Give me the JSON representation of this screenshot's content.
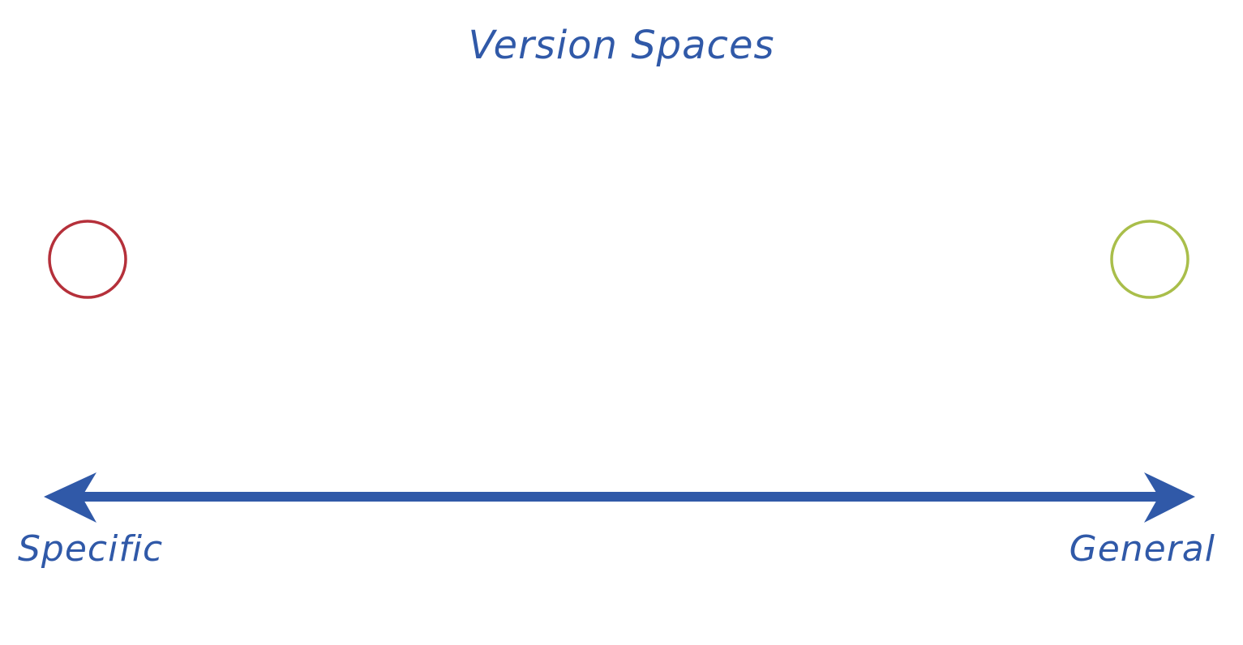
{
  "title": "Version Spaces",
  "axis": {
    "left_label": "Specific",
    "right_label": "General",
    "color": "#3059a8"
  },
  "markers": {
    "specific_circle_color": "#b5303a",
    "general_circle_color": "#a9be4a"
  }
}
